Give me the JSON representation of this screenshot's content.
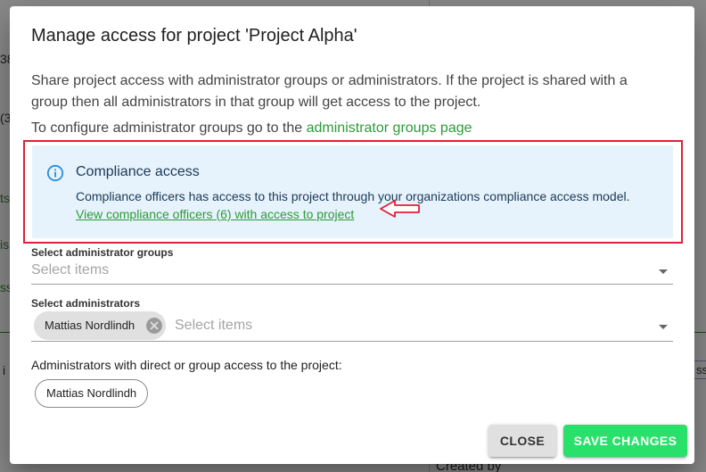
{
  "background": {
    "fragments": [
      "38",
      "(3",
      "ts",
      "is",
      "ss",
      "i",
      "ss",
      "Created by"
    ]
  },
  "dialog": {
    "title": "Manage access for project 'Project Alpha'",
    "description": "Share project access with administrator groups or administrators. If the project is shared with a group then all administrators in that group will get access to the project.",
    "config_prefix": "To configure administrator groups go to the ",
    "config_link": "administrator groups page",
    "alert": {
      "icon": "info-icon",
      "title": "Compliance access",
      "text": "Compliance officers has access to this project through your organizations compliance access model.",
      "link": "View compliance officers (6) with access to project"
    },
    "admin_groups": {
      "label": "Select administrator groups",
      "placeholder": "Select items"
    },
    "administrators": {
      "label": "Select administrators",
      "placeholder": "Select items",
      "selected": [
        "Mattias Nordlindh"
      ]
    },
    "access_list": {
      "label": "Administrators with direct or group access to the project:",
      "items": [
        "Mattias Nordlindh"
      ]
    },
    "buttons": {
      "close": "Close",
      "save": "Save changes"
    }
  },
  "colors": {
    "accent_green": "#2e9a3a",
    "save_button": "#28e06a",
    "alert_bg": "#e6f2fc",
    "annotation_red": "#e0203a"
  }
}
